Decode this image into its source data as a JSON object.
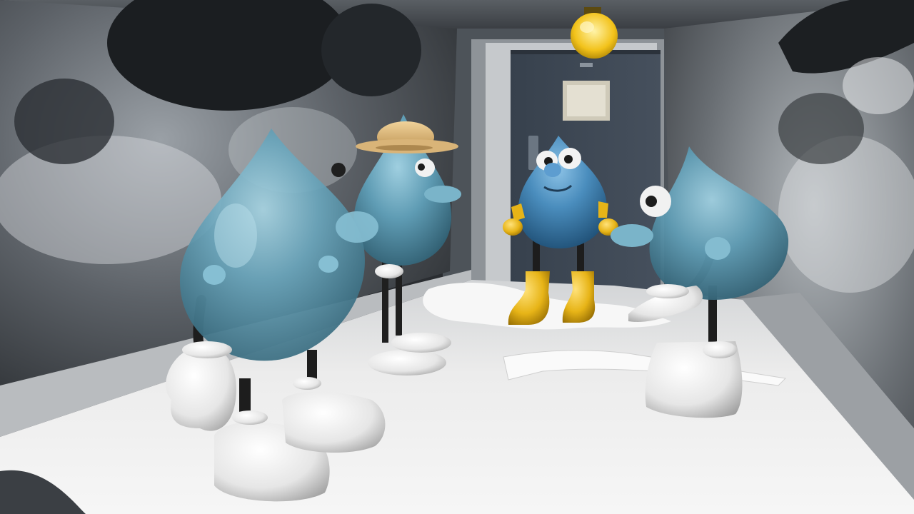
{
  "scene": {
    "type": "3d-render",
    "characters": [
      {
        "role": "foreground-droplet",
        "color": "#5f9fb6"
      },
      {
        "role": "droplet-with-straw-hat",
        "color": "#6aa8c0",
        "hat_color": "#d9b478"
      },
      {
        "role": "droplet-with-yellow-boots",
        "color": "#4e93c4",
        "boots_color": "#e7b417"
      },
      {
        "role": "droplet-right-gesturing",
        "color": "#6aa8bd"
      }
    ],
    "colors": {
      "wall": "#3c4248",
      "door": "#3f4a58",
      "floor": "#e6e6e6",
      "lamp": "#f2c21a"
    }
  }
}
